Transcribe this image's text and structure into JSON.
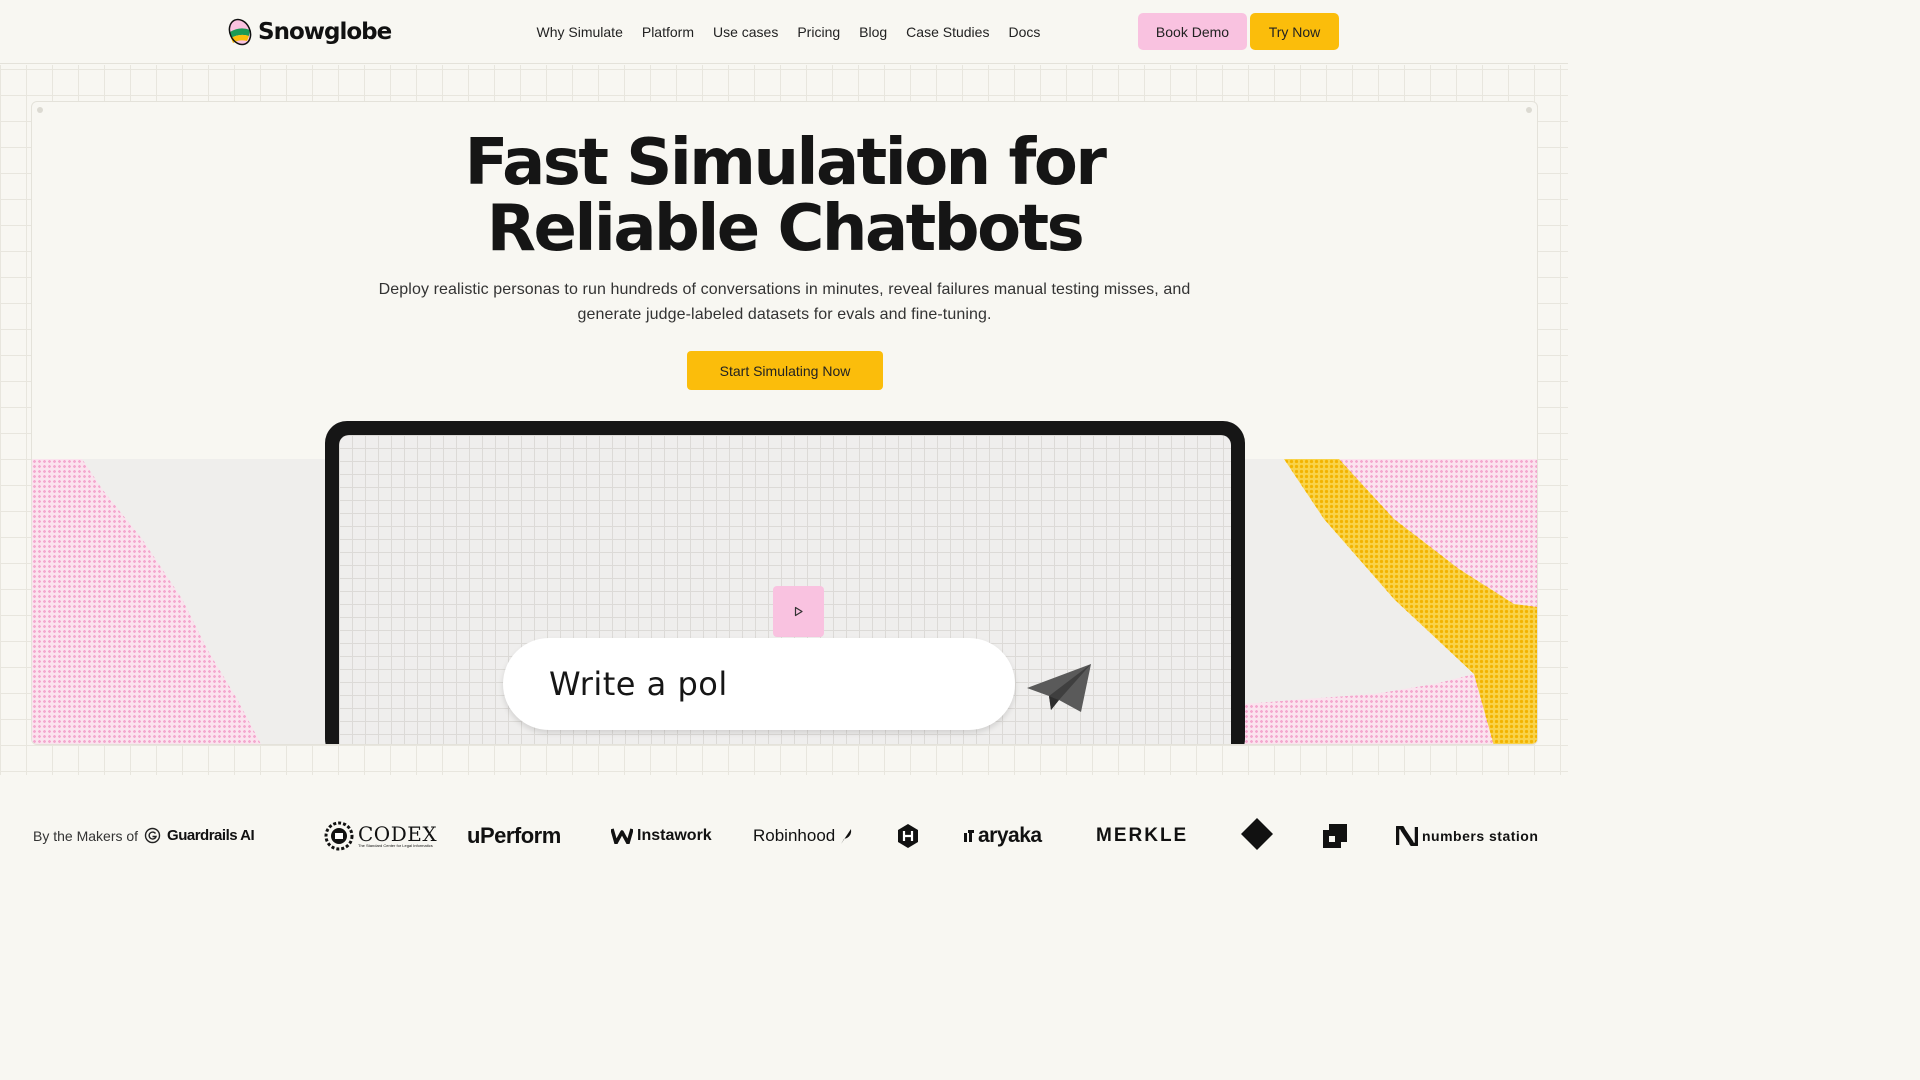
{
  "brand": {
    "name": "Snowglobe"
  },
  "nav": {
    "links": [
      "Why Simulate",
      "Platform",
      "Use cases",
      "Pricing",
      "Blog",
      "Case Studies",
      "Docs"
    ],
    "book_demo": "Book Demo",
    "try_now": "Try Now"
  },
  "hero": {
    "title_line1": "Fast Simulation for",
    "title_line2": "Reliable Chatbots",
    "subtitle_line1": "Deploy realistic personas to run hundreds of conversations in minutes, reveal failures manual testing misses, and",
    "subtitle_line2": "generate judge-labeled datasets for evals and fine-tuning.",
    "cta": "Start Simulating Now"
  },
  "demo": {
    "play_icon": "play-icon",
    "prompt_text": "Write a pol",
    "send_icon": "paper-plane-icon"
  },
  "logos": {
    "makers_prefix": "By the Makers of",
    "makers_brand": "Guardrails AI",
    "brands": [
      "CODEX",
      "uPerform",
      "Instawork",
      "Robinhood",
      "aryaka",
      "MERKLE",
      "numbers station"
    ],
    "codex_tagline": "The Standard Center for Legal Informatics"
  },
  "colors": {
    "accent_yellow": "#fbbd0b",
    "accent_pink": "#f9c2e0",
    "background": "#f8f7f2"
  }
}
